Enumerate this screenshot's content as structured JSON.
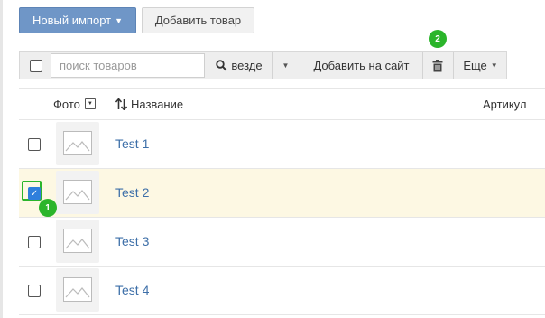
{
  "header": {
    "import_button": "Новый импорт",
    "add_product_button": "Добавить товар"
  },
  "toolbar": {
    "search_placeholder": "поиск товаров",
    "search_scope": "везде",
    "add_to_site": "Добавить на сайт",
    "more": "Еще"
  },
  "markers": {
    "first": "1",
    "second": "2"
  },
  "table": {
    "columns": {
      "photo": "Фото",
      "name": "Название",
      "sku": "Артикул"
    },
    "rows": [
      {
        "name": "Test 1",
        "checked": false
      },
      {
        "name": "Test 2",
        "checked": true
      },
      {
        "name": "Test 3",
        "checked": false
      },
      {
        "name": "Test 4",
        "checked": false
      }
    ]
  },
  "colors": {
    "primary": "#6f96c7",
    "marker": "#2bb52b",
    "link": "#3d6fa8",
    "selected_row": "#fdf8e3",
    "checkbox_checked": "#2f7fdc"
  }
}
